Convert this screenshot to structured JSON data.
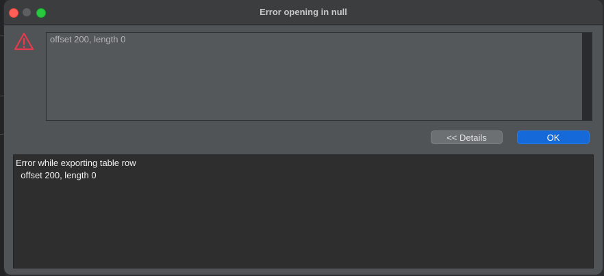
{
  "window": {
    "title": "Error opening in null"
  },
  "icons": {
    "warning": "warning-triangle-icon"
  },
  "message": {
    "text": "offset 200, length 0"
  },
  "buttons": {
    "details_label": "<< Details",
    "ok_label": "OK"
  },
  "details": {
    "line1": "Error while exporting table row",
    "line2": "  offset 200, length 0"
  },
  "colors": {
    "accent": "#1669d8",
    "warning": "#e8394f",
    "close": "#ff5f57",
    "maximize": "#28c840"
  }
}
